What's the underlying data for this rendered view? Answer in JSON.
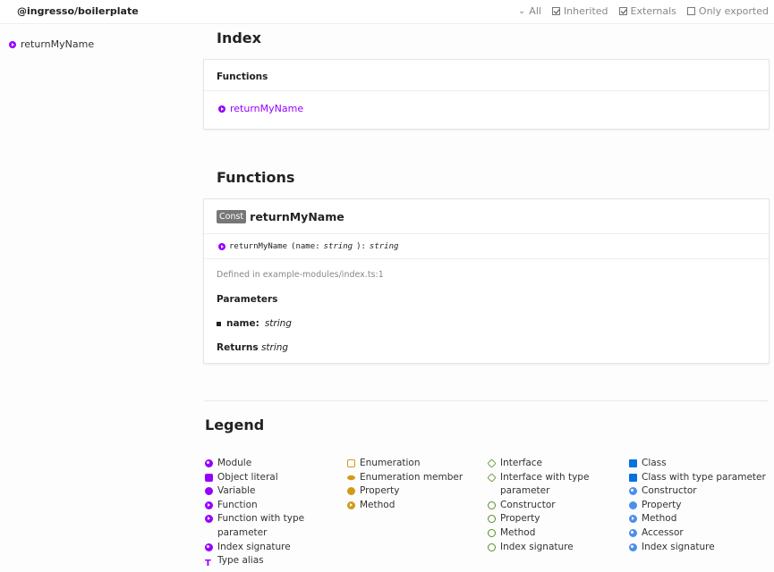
{
  "header": {
    "title": "@ingresso/boilerplate",
    "visibility_label": "All",
    "inherited_label": "Inherited",
    "externals_label": "Externals",
    "only_exported_label": "Only exported"
  },
  "sidebar": {
    "items": [
      {
        "label": "returnMyName",
        "icon": "function-icon"
      }
    ]
  },
  "index": {
    "title": "Index",
    "functions_heading": "Functions",
    "items": [
      "returnMyName"
    ]
  },
  "functions_section": {
    "title": "Functions",
    "fn": {
      "badge": "Const",
      "name": "returnMyName",
      "sig_name": "returnMyName",
      "sig_open": "(name: ",
      "sig_type": "string",
      "sig_close": "): ",
      "sig_ret": "string",
      "defined_in": "Defined in example-modules/index.ts:1",
      "parameters_heading": "Parameters",
      "param_name": "name:",
      "param_type": "string",
      "returns_label": "Returns",
      "returns_type": "string"
    }
  },
  "legend": {
    "title": "Legend",
    "col1": [
      "Module",
      "Object literal",
      "Variable",
      "Function",
      "Function with type parameter",
      "Index signature",
      "Type alias"
    ],
    "col2": [
      "Enumeration",
      "Enumeration member",
      "Property",
      "Method"
    ],
    "col3": [
      "Interface",
      "Interface with type parameter",
      "Constructor",
      "Property",
      "Method",
      "Index signature"
    ],
    "col4": [
      "Class",
      "Class with type parameter",
      "Constructor",
      "Property",
      "Method",
      "Accessor",
      "Index signature"
    ]
  },
  "colors": {
    "accent": "#9600ff",
    "enum": "#d19b1a",
    "interface": "#598d26",
    "class": "#0672de"
  }
}
